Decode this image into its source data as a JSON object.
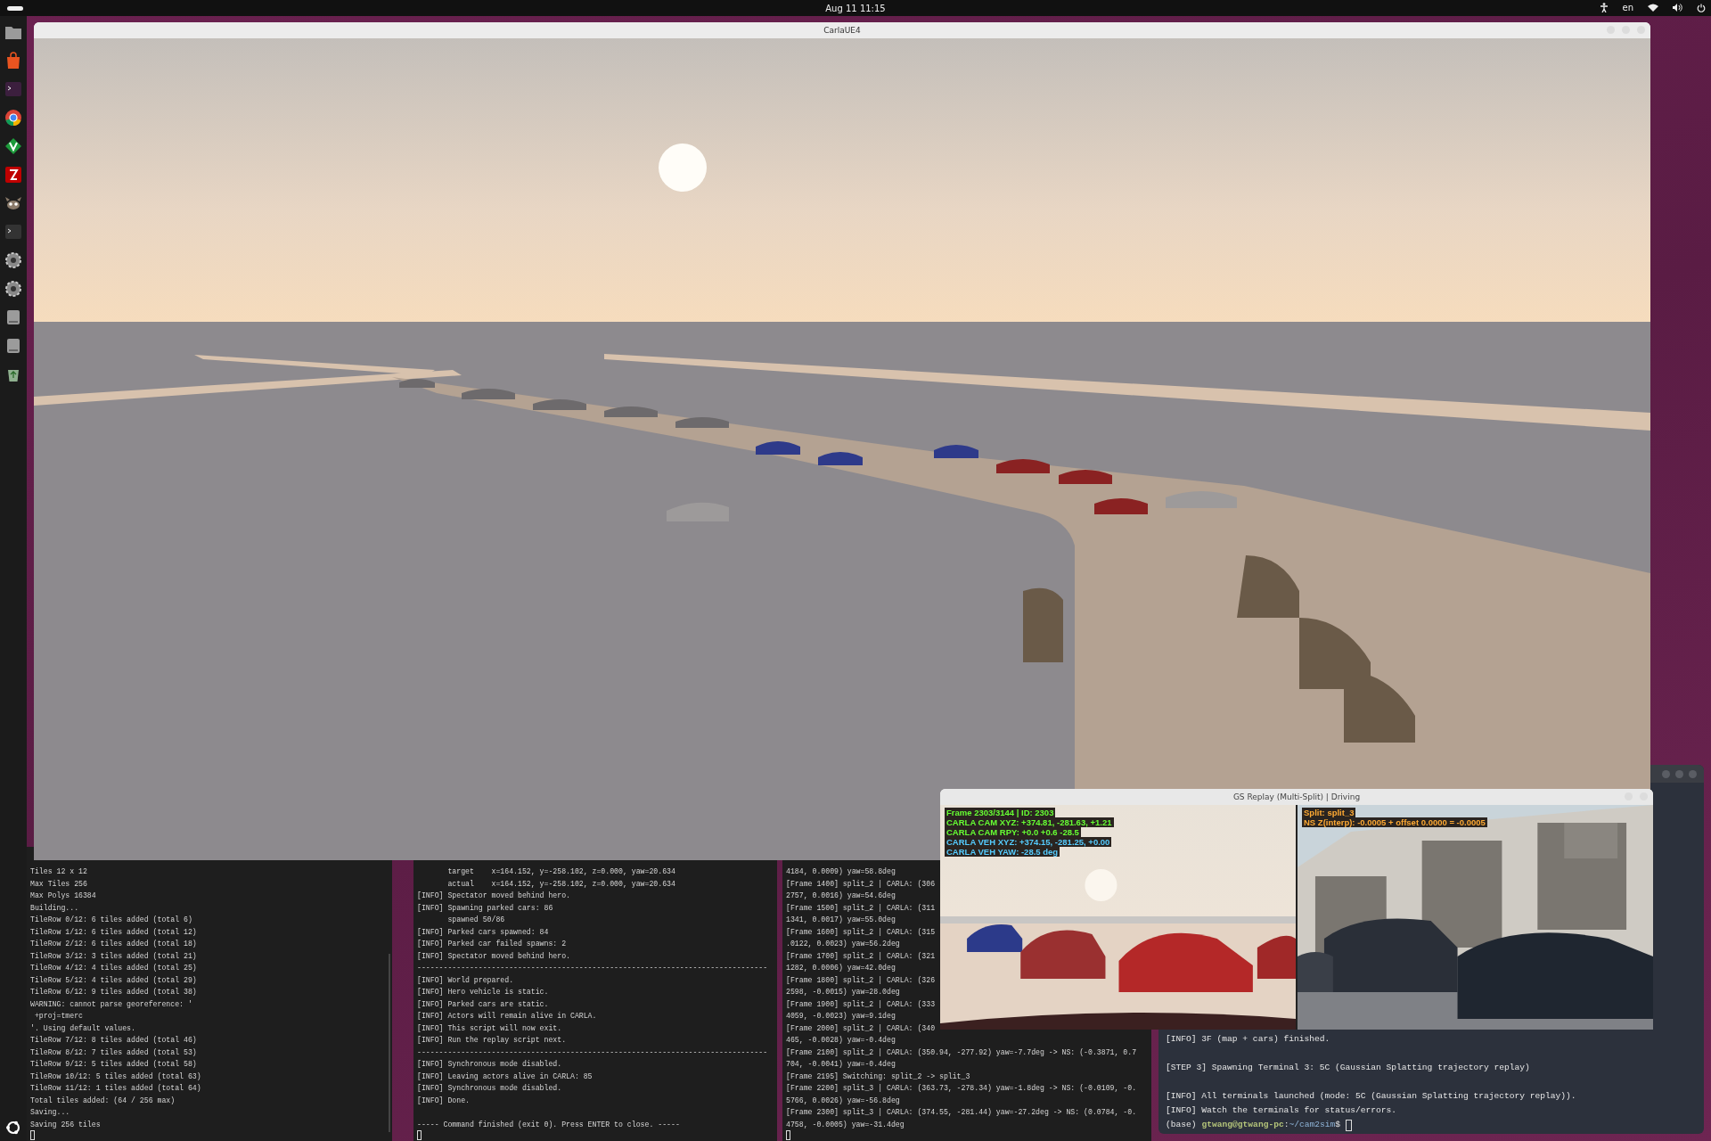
{
  "top_bar": {
    "clock": "Aug 11  11:15",
    "input_source": "en"
  },
  "carla_window": {
    "title": "CarlaUE4"
  },
  "terminals": [
    {
      "lines": [
        "Tiles 12 x 12",
        "Max Tiles 256",
        "Max Polys 16384",
        "Building...",
        "TileRow 0/12: 6 tiles added (total 6)",
        "TileRow 1/12: 6 tiles added (total 12)",
        "TileRow 2/12: 6 tiles added (total 18)",
        "TileRow 3/12: 3 tiles added (total 21)",
        "TileRow 4/12: 4 tiles added (total 25)",
        "TileRow 5/12: 4 tiles added (total 29)",
        "TileRow 6/12: 9 tiles added (total 38)",
        "WARNING: cannot parse georeference: '",
        " +proj=tmerc",
        "'. Using default values.",
        "TileRow 7/12: 8 tiles added (total 46)",
        "TileRow 8/12: 7 tiles added (total 53)",
        "TileRow 9/12: 5 tiles added (total 58)",
        "TileRow 10/12: 5 tiles added (total 63)",
        "TileRow 11/12: 1 tiles added (total 64)",
        "Total tiles added: (64 / 256 max)",
        "Saving...",
        "Saving 256 tiles"
      ]
    },
    {
      "lines": [
        "       target    x=164.152, y=-258.102, z=0.000, yaw=20.634",
        "       actual    x=164.152, y=-258.102, z=0.000, yaw=20.634",
        "[INFO] Spectator moved behind hero.",
        "[INFO] Spawning parked cars: 86",
        "       spawned 50/86",
        "[INFO] Parked cars spawned: 84",
        "[INFO] Parked car failed spawns: 2",
        "[INFO] Spectator moved behind hero.",
        "--------------------------------------------------------------------------------",
        "[INFO] World prepared.",
        "[INFO] Hero vehicle is static.",
        "[INFO] Parked cars are static.",
        "[INFO] Actors will remain alive in CARLA.",
        "[INFO] This script will now exit.",
        "[INFO] Run the replay script next.",
        "--------------------------------------------------------------------------------",
        "[INFO] Synchronous mode disabled.",
        "[INFO] Leaving actors alive in CARLA: 85",
        "[INFO] Synchronous mode disabled.",
        "[INFO] Done."
      ],
      "footer": "----- Command finished (exit 0). Press ENTER to close. -----"
    },
    {
      "lines": [
        "4184, 0.0009) yaw=58.8deg",
        "[Frame 1400] split_2 | CARLA: (306",
        "2757, 0.0016) yaw=54.6deg",
        "[Frame 1500] split_2 | CARLA: (311",
        "1341, 0.0017) yaw=55.0deg",
        "[Frame 1600] split_2 | CARLA: (315",
        ".0122, 0.0023) yaw=56.2deg",
        "[Frame 1700] split_2 | CARLA: (321",
        "1282, 0.0006) yaw=42.0deg",
        "[Frame 1800] split_2 | CARLA: (326",
        "2598, -0.0015) yaw=28.0deg",
        "[Frame 1900] split_2 | CARLA: (333",
        "4059, -0.0023) yaw=9.1deg",
        "[Frame 2000] split_2 | CARLA: (340",
        "465, -0.0028) yaw=-0.4deg",
        "[Frame 2100] split_2 | CARLA: (350.94, -277.92) yaw=-7.7deg -> NS: (-0.3871, 0.7",
        "704, -0.0041) yaw=-0.4deg",
        "[Frame 2195] Switching: split_2 -> split_3",
        "[Frame 2200] split_3 | CARLA: (363.73, -278.34) yaw=-1.8deg -> NS: (-0.0109, -0.",
        "5766, 0.0026) yaw=-56.8deg",
        "[Frame 2300] split_3 | CARLA: (374.55, -281.44) yaw=-27.2deg -> NS: (0.0784, -0.",
        "4758, -0.0005) yaw=-31.4deg"
      ]
    }
  ],
  "shell_terminal": {
    "blocks": [
      [
        "[INFO] 3F (map + cars) finished."
      ],
      [
        "[STEP 3] Spawning Terminal 3: 5C (Gaussian Splatting trajectory replay)"
      ],
      [
        "[INFO] All terminals launched (mode: 5C (Gaussian Splatting trajectory replay)).",
        "[INFO] Watch the terminals for status/errors."
      ]
    ],
    "prompt": {
      "env": "(base)",
      "user_host": "gtwang@gtwang-pc",
      "separator": ":",
      "path": "~/cam2sim",
      "symbol": "$"
    }
  },
  "gs_replay_window": {
    "title": "GS Replay (Multi-Split) | Driving",
    "left_overlay": [
      {
        "text": "Frame 2303/3144 | ID: 2303",
        "kind": "camera"
      },
      {
        "text": "CARLA CAM XYZ: +374.81, -281.63, +1.21",
        "kind": "camera"
      },
      {
        "text": "CARLA CAM RPY: +0.0  +0.6  -28.5",
        "kind": "camera"
      },
      {
        "text": "CARLA VEH XYZ: +374.15, -281.25, +0.00",
        "kind": "vehicle"
      },
      {
        "text": "CARLA VEH YAW: -28.5 deg",
        "kind": "vehicle"
      }
    ],
    "right_overlay": [
      {
        "text": "Split: split_3",
        "kind": "split"
      },
      {
        "text": "NS Z(interp): -0.0005 + offset 0.0000 = -0.0005",
        "kind": "split"
      }
    ]
  }
}
